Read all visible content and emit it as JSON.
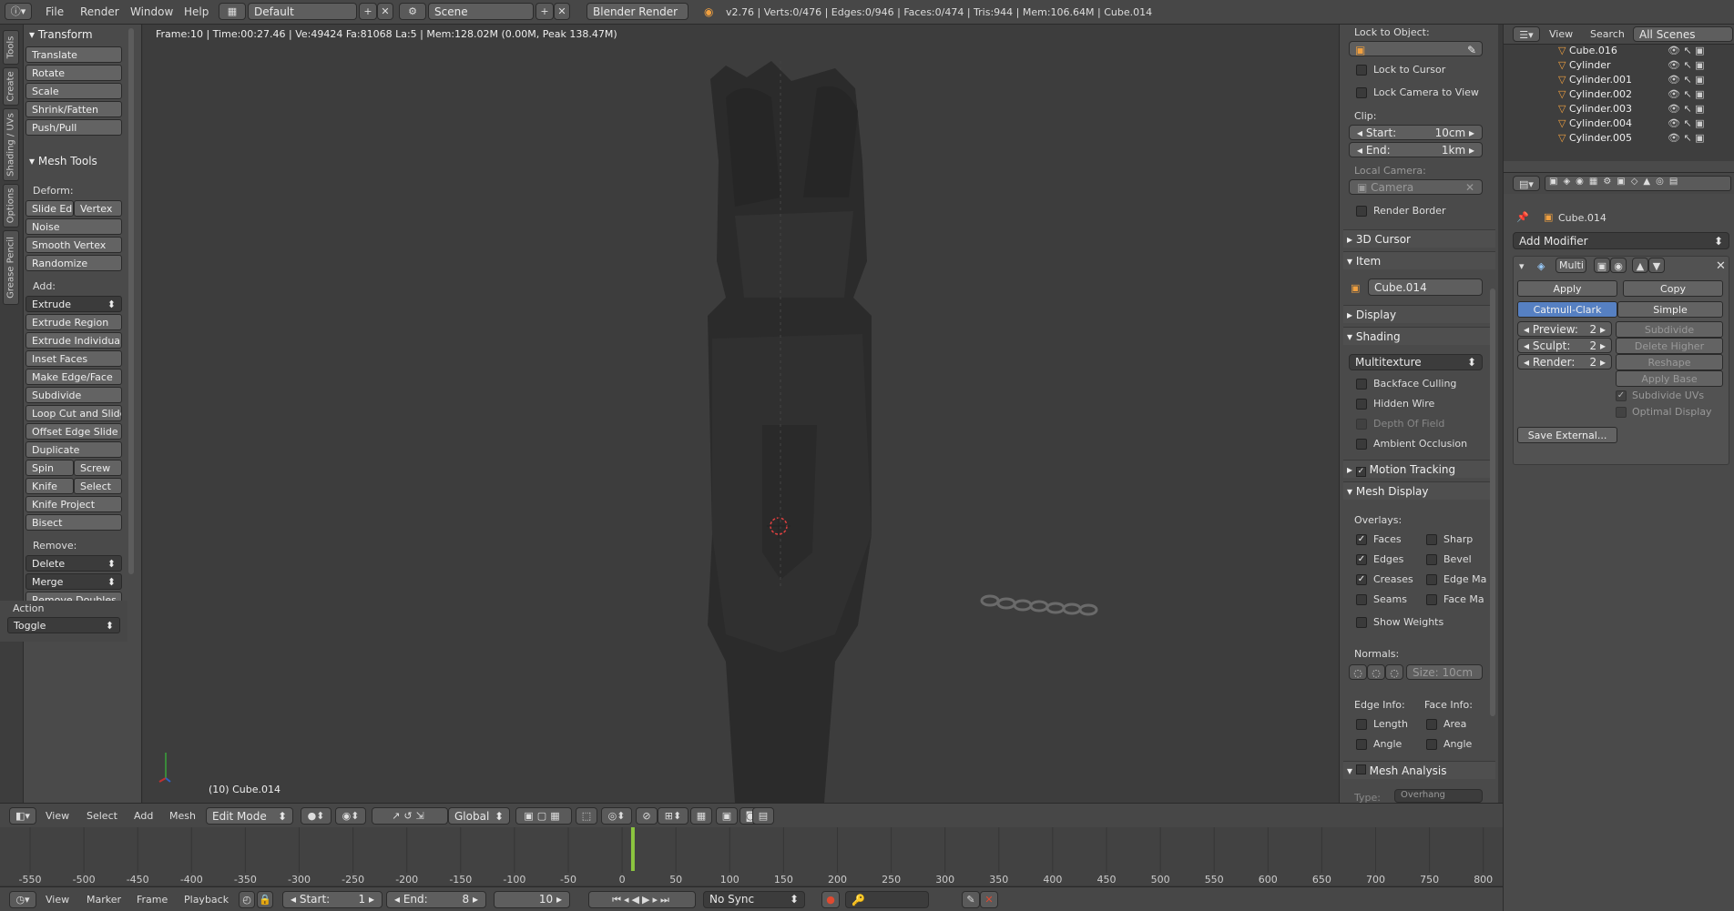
{
  "top_menu": [
    "File",
    "Render",
    "Window",
    "Help"
  ],
  "screen_layout": "Default",
  "scene": "Scene",
  "render_engine": "Blender Render",
  "stats": "v2.76 | Verts:0/476 | Edges:0/946 | Faces:0/474 | Tris:944 | Mem:106.64M | Cube.014",
  "left_tabs": [
    "Tools",
    "Create",
    "Shading / UVs",
    "Options",
    "Grease Pencil"
  ],
  "transform": {
    "title": "Transform",
    "buttons": [
      "Translate",
      "Rotate",
      "Scale",
      "Shrink/Fatten",
      "Push/Pull"
    ]
  },
  "mesh_tools": {
    "title": "Mesh Tools",
    "deform_label": "Deform:",
    "slide_edge": "Slide Ed",
    "vertex": "Vertex",
    "noise": "Noise",
    "smooth_vertex": "Smooth Vertex",
    "randomize": "Randomize",
    "add_label": "Add:",
    "extrude": "Extrude",
    "add_buttons": [
      "Extrude Region",
      "Extrude Individual",
      "Inset Faces",
      "Make Edge/Face",
      "Subdivide",
      "Loop Cut and Slide",
      "Offset Edge Slide",
      "Duplicate"
    ],
    "spin": "Spin",
    "screw": "Screw",
    "knife": "Knife",
    "select": "Select",
    "knife_project": "Knife Project",
    "bisect": "Bisect",
    "remove_label": "Remove:",
    "delete": "Delete",
    "merge": "Merge",
    "remove_doubles": "Remove Doubles"
  },
  "action": {
    "title": "Action",
    "value": "Toggle"
  },
  "viewport": {
    "info": "Frame:10 | Time:00:27.46 | Ve:49424 Fa:81068 La:5 | Mem:128.02M (0.00M, Peak 138.47M)",
    "object_label": "(10) Cube.014"
  },
  "npanel": {
    "lock_to_object": "Lock to Object:",
    "lock_to_cursor": "Lock to Cursor",
    "lock_camera": "Lock Camera to View",
    "clip": "Clip:",
    "start_label": "Start:",
    "start_value": "10cm",
    "end_label": "End:",
    "end_value": "1km",
    "local_camera": "Local Camera:",
    "camera": "Camera",
    "render_border": "Render Border",
    "cursor_3d": "3D Cursor",
    "item": "Item",
    "item_name": "Cube.014",
    "display": "Display",
    "shading": "Shading",
    "shading_mode": "Multitexture",
    "backface_culling": "Backface Culling",
    "hidden_wire": "Hidden Wire",
    "depth_of_field": "Depth Of Field",
    "ambient_occlusion": "Ambient Occlusion",
    "motion_tracking": "Motion Tracking",
    "mesh_display": "Mesh Display",
    "overlays": "Overlays:",
    "faces": "Faces",
    "sharp": "Sharp",
    "edges": "Edges",
    "bevel": "Bevel",
    "creases": "Creases",
    "edge_marks": "Edge Ma",
    "seams": "Seams",
    "face_marks": "Face Ma",
    "show_weights": "Show Weights",
    "normals": "Normals:",
    "normals_size": "Size: 10cm",
    "edge_info": "Edge Info:",
    "face_info": "Face Info:",
    "length": "Length",
    "area": "Area",
    "angle1": "Angle",
    "angle2": "Angle",
    "mesh_analysis": "Mesh Analysis",
    "type_label": "Type:",
    "type_value": "Overhang"
  },
  "outliner": {
    "menu": [
      "View",
      "Search"
    ],
    "filter": "All Scenes",
    "items": [
      "Cube.016",
      "Cylinder",
      "Cylinder.001",
      "Cylinder.002",
      "Cylinder.003",
      "Cylinder.004",
      "Cylinder.005"
    ]
  },
  "properties": {
    "object_name": "Cube.014",
    "add_modifier": "Add Modifier",
    "modifier_name": "Multi",
    "apply": "Apply",
    "copy": "Copy",
    "catmull_clark": "Catmull-Clark",
    "simple": "Simple",
    "preview": "Preview:",
    "preview_value": "2",
    "sculpt": "Sculpt:",
    "sculpt_value": "2",
    "render": "Render:",
    "render_value": "2",
    "subdivide": "Subdivide",
    "delete_higher": "Delete Higher",
    "reshape": "Reshape",
    "apply_base": "Apply Base",
    "subdivide_uvs": "Subdivide UVs",
    "optimal_display": "Optimal Display",
    "save_external": "Save External..."
  },
  "view3d_header": {
    "menus": [
      "View",
      "Select",
      "Add",
      "Mesh"
    ],
    "mode": "Edit Mode",
    "orientation": "Global"
  },
  "timeline": {
    "ticks": [
      "-550",
      "-500",
      "-450",
      "-400",
      "-350",
      "-300",
      "-250",
      "-200",
      "-150",
      "-100",
      "-50",
      "0",
      "50",
      "100",
      "150",
      "200",
      "250",
      "300",
      "350",
      "400",
      "450",
      "500",
      "550",
      "600",
      "650",
      "700",
      "750",
      "800"
    ],
    "current_frame_value": 10
  },
  "timeline_header": {
    "menus": [
      "View",
      "Marker",
      "Frame",
      "Playback"
    ],
    "start_label": "Start:",
    "start": "1",
    "end_label": "End:",
    "end": "8",
    "current": "10",
    "sync": "No Sync"
  }
}
